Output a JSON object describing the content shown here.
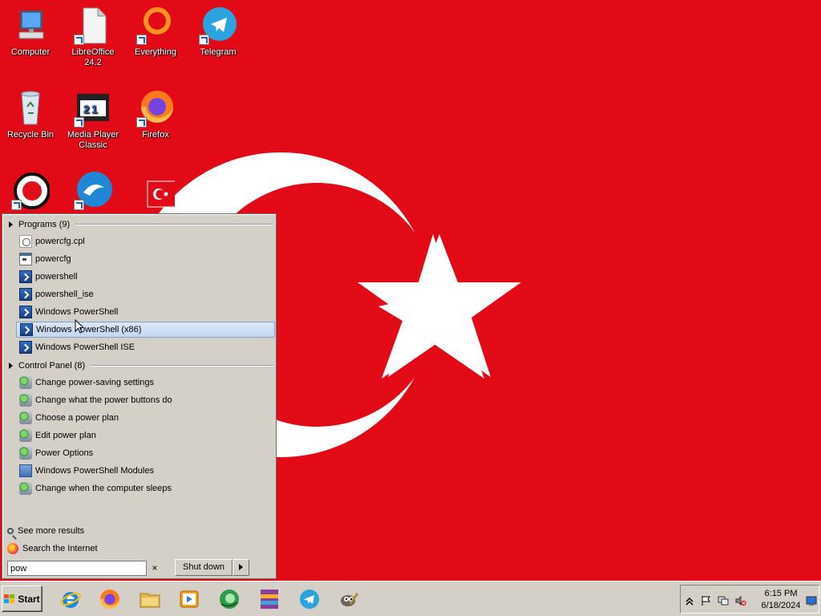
{
  "desktop": {
    "icons": [
      {
        "label": "Computer"
      },
      {
        "label": "LibreOffice 24.2"
      },
      {
        "label": "Everything"
      },
      {
        "label": "Telegram"
      },
      {
        "label": "Recycle Bin"
      },
      {
        "label": "Media Player Classic"
      },
      {
        "label": "Firefox"
      }
    ]
  },
  "start_menu": {
    "programs_header": "Programs (9)",
    "programs": [
      {
        "label": "powercfg.cpl",
        "icon": "cpl-icon"
      },
      {
        "label": "powercfg",
        "icon": "console-window-icon"
      },
      {
        "label": "powershell",
        "icon": "powershell-icon"
      },
      {
        "label": "powershell_ise",
        "icon": "powershell-ise-icon"
      },
      {
        "label": "Windows PowerShell",
        "icon": "powershell-icon"
      },
      {
        "label": "Windows PowerShell (x86)",
        "icon": "powershell-icon",
        "selected": true
      },
      {
        "label": "Windows PowerShell ISE",
        "icon": "powershell-ise-icon"
      }
    ],
    "control_panel_header": "Control Panel (8)",
    "control_panel": [
      {
        "label": "Change power-saving settings",
        "icon": "power-options-icon"
      },
      {
        "label": "Change what the power buttons do",
        "icon": "power-options-icon"
      },
      {
        "label": "Choose a power plan",
        "icon": "power-options-icon"
      },
      {
        "label": "Edit power plan",
        "icon": "power-options-icon"
      },
      {
        "label": "Power Options",
        "icon": "power-options-icon"
      },
      {
        "label": "Windows PowerShell Modules",
        "icon": "powershell-modules-icon"
      },
      {
        "label": "Change when the computer sleeps",
        "icon": "power-options-icon"
      }
    ],
    "see_more": "See more results",
    "search_internet": "Search the Internet",
    "search_value": "pow",
    "clear_label": "×",
    "shutdown_label": "Shut down"
  },
  "taskbar": {
    "start_label": "Start",
    "apps": [
      "internet-explorer-icon",
      "firefox-icon",
      "file-explorer-icon",
      "media-player-icon",
      "greenshot-icon",
      "winrar-icon",
      "telegram-icon",
      "gimp-icon"
    ],
    "tray": {
      "time": "6:15 PM",
      "date": "6/18/2024"
    }
  },
  "colors": {
    "wallpaper": "#e30a17",
    "menu_bg": "#d4d0c8",
    "selection": "#c4d6ef"
  }
}
